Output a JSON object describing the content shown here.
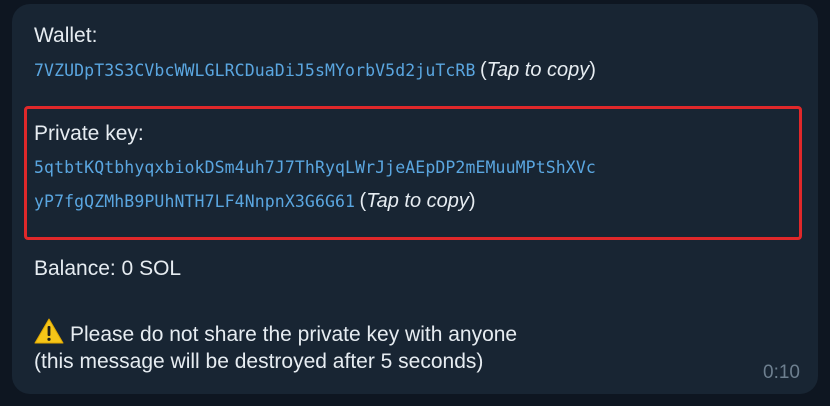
{
  "message": {
    "wallet_label": "Wallet:",
    "wallet_address": "7VZUDpT3S3CVbcWWLGLRCDuaDiJ5sMYorbV5d2juTcRB",
    "private_key_label": "Private key:",
    "private_key_line1": "5qtbtKQtbhyqxbiokDSm4uh7J7ThRyqLWrJjeAEpDP2mEMuuMPtShXVc",
    "private_key_line2": "yP7fgQZMhB9PUhNTH7LF4NnpnX3G6G61",
    "tap_to_copy": "Tap to copy",
    "open_paren": "(",
    "close_paren": ")",
    "balance": "Balance: 0 SOL",
    "warning_line1": "Please do not share the private key with anyone",
    "warning_line2": "(this message will be destroyed after 5 seconds)",
    "time": "0:10"
  },
  "colors": {
    "background": "#0e1621",
    "bubble": "#182533",
    "mono_link": "#5aa6e0",
    "highlight": "#e0282a",
    "time": "#6d7f8f"
  },
  "icons": {
    "warning": "warning-triangle-icon"
  }
}
